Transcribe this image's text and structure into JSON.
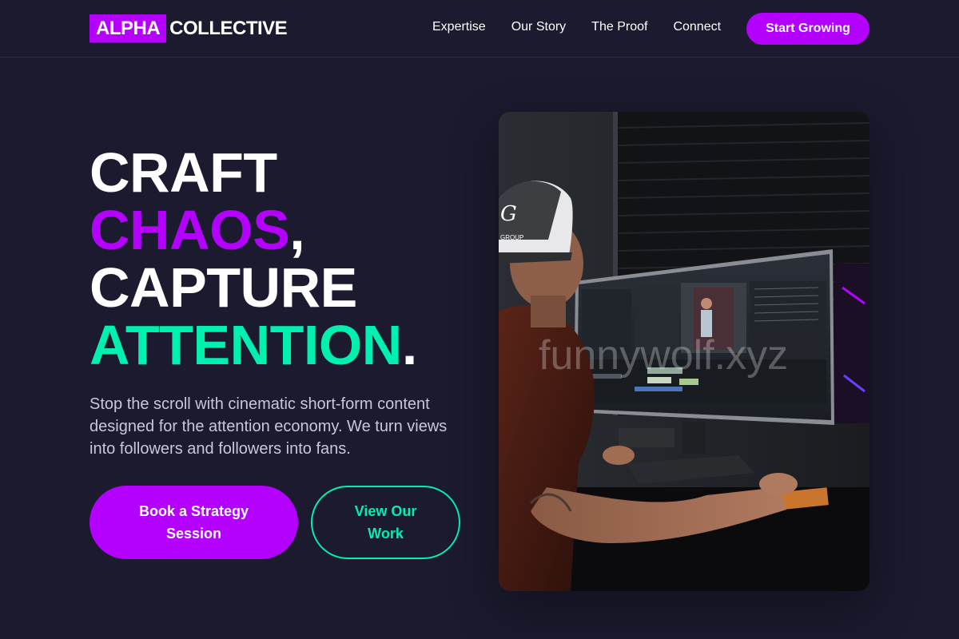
{
  "header": {
    "logo_mark": "ALPHA",
    "logo_text": "COLLECTIVE",
    "nav": [
      "Expertise",
      "Our Story",
      "The Proof",
      "Connect"
    ],
    "cta_label": "Start Growing"
  },
  "hero": {
    "title": {
      "line1": "CRAFT",
      "line2_accent": "CHAOS",
      "line2_punct": ",",
      "line3": "CAPTURE",
      "line4_accent": "ATTENTION",
      "line4_punct": "."
    },
    "description": "Stop the scroll with cinematic short-form content designed for the attention economy. We turn views into followers and followers into fans.",
    "primary_button": "Book a Strategy Session",
    "secondary_button": "View Our Work",
    "image": {
      "cap_text": "G\nGROUP",
      "watermark": "funnywolf.xyz"
    }
  },
  "colors": {
    "background": "#1b1a2e",
    "accent_purple": "#b400ff",
    "accent_teal": "#00f0b0"
  }
}
